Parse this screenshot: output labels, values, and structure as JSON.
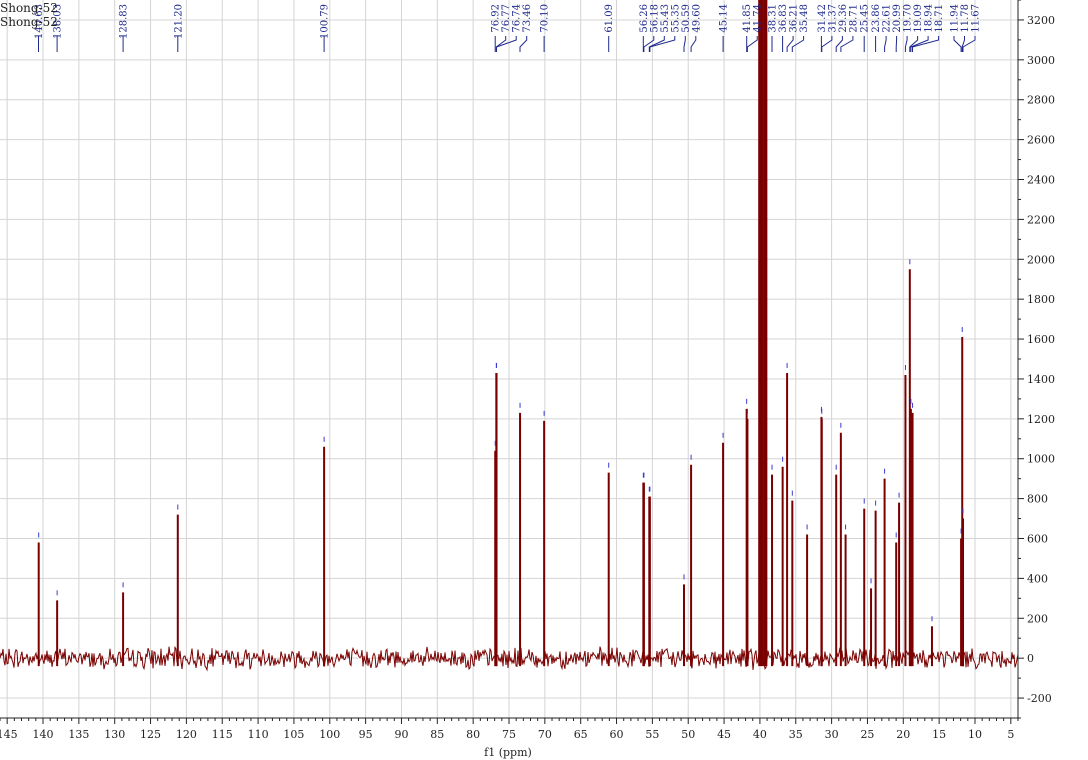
{
  "window": {
    "sample_labels": [
      "Shong-52",
      "Shong-52"
    ]
  },
  "chart_data": {
    "type": "line",
    "title": "",
    "xlabel": "f1 (ppm)",
    "ylabel": "",
    "xlim": [
      146,
      4
    ],
    "ylim": [
      -300,
      3300
    ],
    "x_reversed": true,
    "grid": true,
    "x_ticks": [
      145,
      140,
      135,
      130,
      125,
      120,
      115,
      110,
      105,
      100,
      95,
      90,
      85,
      80,
      75,
      70,
      65,
      60,
      55,
      50,
      45,
      40,
      35,
      30,
      25,
      20,
      15,
      10,
      5
    ],
    "y_ticks": [
      -200,
      0,
      200,
      400,
      600,
      800,
      1000,
      1200,
      1400,
      1600,
      1800,
      2000,
      2200,
      2400,
      2600,
      2800,
      3000,
      3200
    ],
    "series": [
      {
        "peaks": [
          {
            "x": 140.6,
            "y": 580
          },
          {
            "x": 138.03,
            "y": 290
          },
          {
            "x": 128.83,
            "y": 330
          },
          {
            "x": 121.2,
            "y": 720
          },
          {
            "x": 100.79,
            "y": 1060
          },
          {
            "x": 76.92,
            "y": 1040
          },
          {
            "x": 76.77,
            "y": 1430
          },
          {
            "x": 76.74,
            "y": 1430
          },
          {
            "x": 73.46,
            "y": 1230
          },
          {
            "x": 70.1,
            "y": 1190
          },
          {
            "x": 61.09,
            "y": 930
          },
          {
            "x": 56.26,
            "y": 880
          },
          {
            "x": 56.18,
            "y": 880
          },
          {
            "x": 55.43,
            "y": 810
          },
          {
            "x": 55.35,
            "y": 810
          },
          {
            "x": 50.59,
            "y": 370
          },
          {
            "x": 49.6,
            "y": 970
          },
          {
            "x": 45.14,
            "y": 1080
          },
          {
            "x": 41.85,
            "y": 1250
          },
          {
            "x": 41.74,
            "y": 1200
          },
          {
            "x": 40.1,
            "y": 3300
          },
          {
            "x": 39.85,
            "y": 3300
          },
          {
            "x": 39.6,
            "y": 3300
          },
          {
            "x": 39.35,
            "y": 3300
          },
          {
            "x": 39.1,
            "y": 3300
          },
          {
            "x": 38.31,
            "y": 920
          },
          {
            "x": 36.83,
            "y": 960
          },
          {
            "x": 36.21,
            "y": 1430
          },
          {
            "x": 35.48,
            "y": 790
          },
          {
            "x": 33.42,
            "y": 620
          },
          {
            "x": 31.42,
            "y": 1210
          },
          {
            "x": 31.37,
            "y": 1200
          },
          {
            "x": 29.36,
            "y": 920
          },
          {
            "x": 28.71,
            "y": 1130
          },
          {
            "x": 28.05,
            "y": 620
          },
          {
            "x": 25.45,
            "y": 750
          },
          {
            "x": 24.5,
            "y": 350
          },
          {
            "x": 23.86,
            "y": 740
          },
          {
            "x": 22.61,
            "y": 900
          },
          {
            "x": 20.99,
            "y": 580
          },
          {
            "x": 20.59,
            "y": 780
          },
          {
            "x": 19.7,
            "y": 1420
          },
          {
            "x": 19.09,
            "y": 1950
          },
          {
            "x": 18.94,
            "y": 1250
          },
          {
            "x": 18.71,
            "y": 1230
          },
          {
            "x": 16.0,
            "y": 160
          },
          {
            "x": 11.94,
            "y": 600
          },
          {
            "x": 11.78,
            "y": 1610
          },
          {
            "x": 11.67,
            "y": 700
          }
        ]
      }
    ],
    "peak_labels": [
      "140.63",
      "138.03",
      "128.83",
      "121.20",
      "100.79",
      "76.92",
      "76.77",
      "76.74",
      "73.46",
      "70.10",
      "61.09",
      "56.26",
      "56.18",
      "55.43",
      "55.35",
      "50.59",
      "49.60",
      "45.14",
      "41.85",
      "41.74",
      "38.31",
      "36.83",
      "36.21",
      "35.48",
      "31.42",
      "31.37",
      "29.36",
      "28.71",
      "25.45",
      "23.86",
      "22.61",
      "20.99",
      "19.70",
      "19.09",
      "18.94",
      "18.71",
      "11.94",
      "11.78",
      "11.67"
    ],
    "colors": {
      "spectrum": "#7a0000",
      "labels": "#1f2a8c",
      "grid": "#d4d4d4",
      "axis": "#222222",
      "integral_marker": "#3a3ad0"
    }
  }
}
